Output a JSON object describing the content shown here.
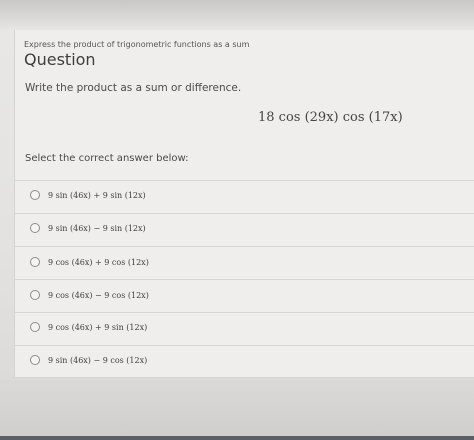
{
  "breadcrumb": "Express the product of trigonometric functions as a sum",
  "question_title": "Question",
  "instruction": "Write the product as a sum or difference.",
  "expression": "18 cos (29x) cos (17x)",
  "select_label": "Select the correct answer below:",
  "options": [
    {
      "label": "9 sin (46x) + 9 sin (12x)"
    },
    {
      "label": "9 sin (46x) − 9 sin (12x)"
    },
    {
      "label": "9 cos (46x) + 9 cos (12x)"
    },
    {
      "label": "9 cos (46x) − 9 cos (12x)"
    },
    {
      "label": "9 cos (46x) + 9 sin (12x)"
    },
    {
      "label": "9 sin (46x) − 9 cos (12x)"
    }
  ]
}
